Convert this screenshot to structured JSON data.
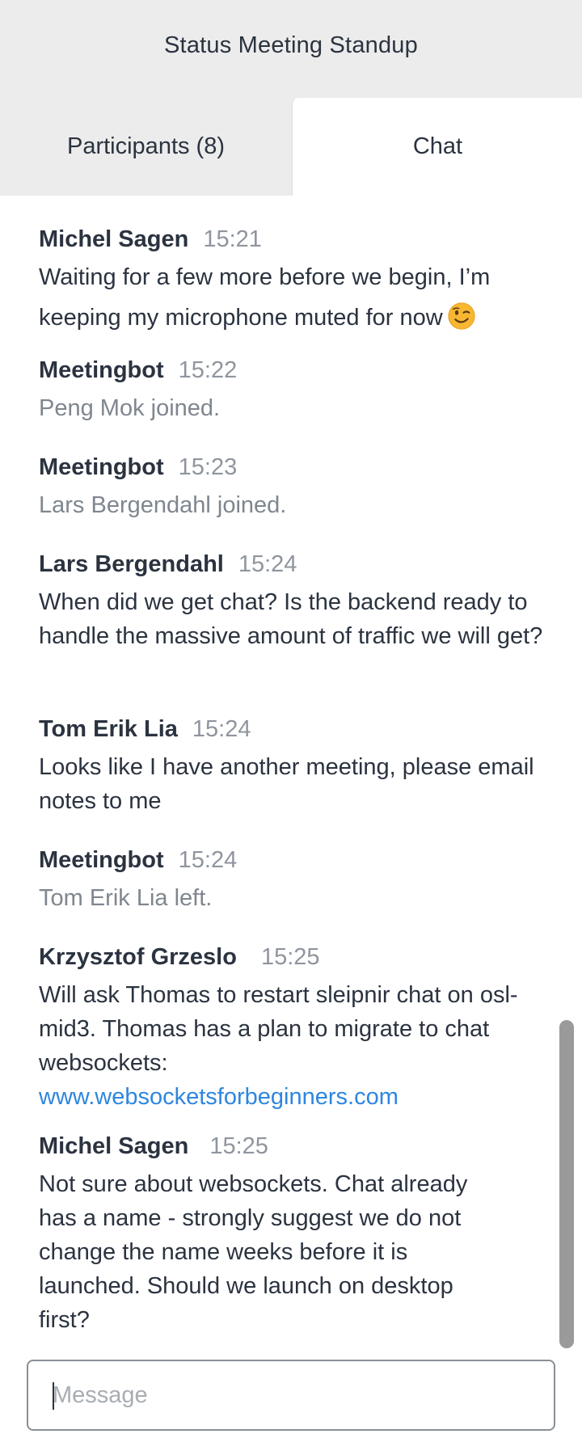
{
  "header": {
    "title": "Status Meeting Standup"
  },
  "tabs": {
    "participants": "Participants (8)",
    "chat": "Chat"
  },
  "messages": [
    {
      "author": "Michel Sagen",
      "time": "15:21",
      "text": "Waiting for a few more before we begin, I’m keeping my microphone muted for now",
      "emoji": "winking-face-icon"
    },
    {
      "author": "Meetingbot",
      "time": "15:22",
      "text": "Peng Mok joined."
    },
    {
      "author": "Meetingbot",
      "time": "15:23",
      "text": "Lars Bergendahl joined."
    },
    {
      "author": "Lars Bergendahl",
      "time": "15:24",
      "text": "When did we get chat? Is the backend ready to handle the massive amount of traffic we will get?"
    },
    {
      "author": "Tom Erik Lia",
      "time": "15:24",
      "text": "Looks like I have another meeting, please email notes to me"
    },
    {
      "author": "Meetingbot",
      "time": "15:24",
      "text": "Tom Erik Lia left."
    },
    {
      "author": "Krzysztof Grzeslo",
      "time": "15:25",
      "text": "Will ask Thomas to restart sleipnir chat on osl-mid3. Thomas has a plan to migrate to chat websockets:",
      "link": "www.websocketsforbeginners.com"
    },
    {
      "author": "Michel Sagen",
      "time": "15:25",
      "text": "Not sure about websockets. Chat already has a name - strongly suggest we do not change the name weeks before it is launched. Should we launch on desktop first?"
    }
  ],
  "composer": {
    "placeholder": "Message"
  },
  "colors": {
    "header_bg": "#ececec",
    "text": "#2b3340",
    "muted": "#8f959e",
    "link": "#2e86de"
  }
}
